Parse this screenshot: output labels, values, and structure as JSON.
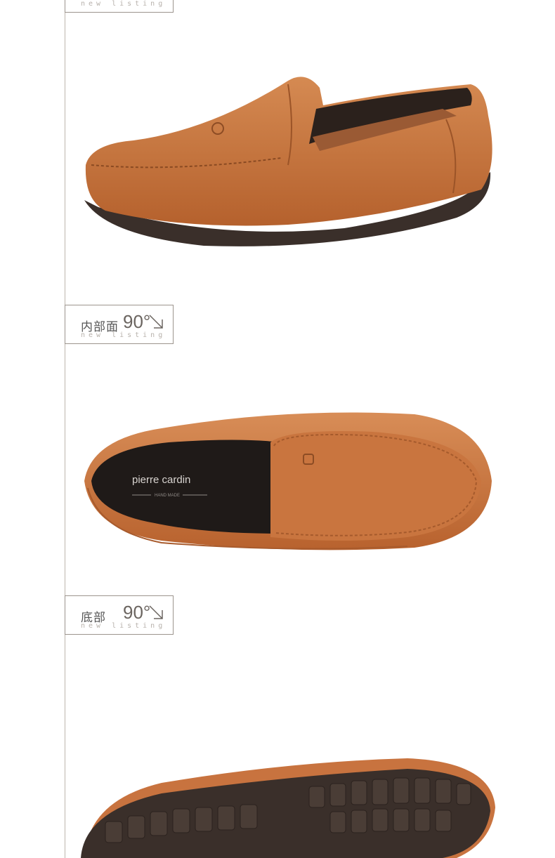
{
  "sections": [
    {
      "label_cn": "",
      "degree": "",
      "label_en": "new listing"
    },
    {
      "label_cn": "内部面",
      "degree": "90°",
      "label_en": "new listing"
    },
    {
      "label_cn": "底部",
      "degree": "90°",
      "label_en": "new listing"
    }
  ],
  "insole_brand": "pierre cardin",
  "insole_subtext": "HAND MADE",
  "colors": {
    "leather": "#c8733f",
    "sole": "#3a2f2a",
    "line": "#bdb5ad"
  }
}
